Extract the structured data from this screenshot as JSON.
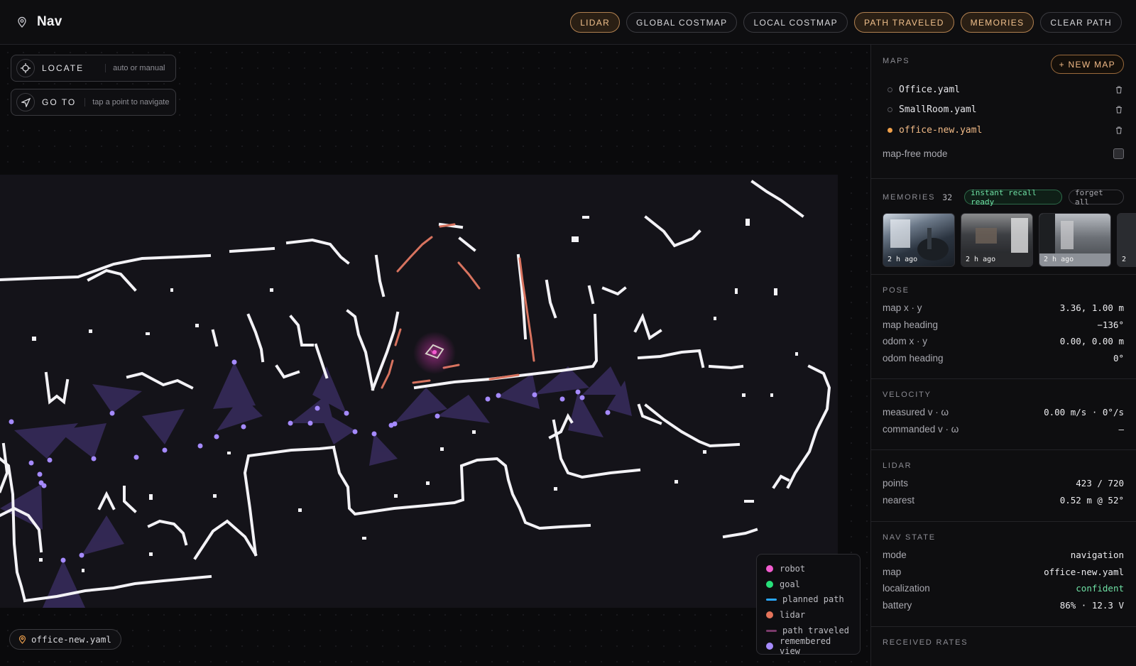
{
  "app": {
    "title": "Nav"
  },
  "toggles": [
    {
      "label": "LIDAR",
      "active": true
    },
    {
      "label": "GLOBAL COSTMAP",
      "active": false
    },
    {
      "label": "LOCAL COSTMAP",
      "active": false
    },
    {
      "label": "PATH TRAVELED",
      "active": true
    },
    {
      "label": "MEMORIES",
      "active": true
    },
    {
      "label": "CLEAR PATH",
      "active": false
    }
  ],
  "actions": {
    "locate": {
      "label": "LOCATE",
      "hint": "auto or manual"
    },
    "goto": {
      "label": "GO TO",
      "hint": "tap a point to navigate"
    }
  },
  "current_map_chip": "office-new.yaml",
  "legend": [
    {
      "label": "robot",
      "color": "#f25ccf",
      "kind": "dot"
    },
    {
      "label": "goal",
      "color": "#27e07a",
      "kind": "dot"
    },
    {
      "label": "planned path",
      "color": "#2aa8ff",
      "kind": "bar"
    },
    {
      "label": "lidar",
      "color": "#e4735a",
      "kind": "dot"
    },
    {
      "label": "path traveled",
      "color": "#7a3a6a",
      "kind": "bar"
    },
    {
      "label": "remembered view",
      "color": "#a68bff",
      "kind": "dot"
    }
  ],
  "sidebar": {
    "maps": {
      "heading": "MAPS",
      "new_label": "+ NEW MAP",
      "items": [
        {
          "name": "Office.yaml",
          "selected": false
        },
        {
          "name": "SmallRoom.yaml",
          "selected": false
        },
        {
          "name": "office-new.yaml",
          "selected": true
        }
      ],
      "map_free_label": "map-free mode"
    },
    "memories": {
      "heading": "MEMORIES",
      "count": "32",
      "status": "instant recall ready",
      "forget": "forget all",
      "thumbs": [
        {
          "ago": "2 h ago"
        },
        {
          "ago": "2 h ago"
        },
        {
          "ago": "2 h ago"
        },
        {
          "ago": "2"
        }
      ]
    },
    "pose": {
      "heading": "POSE",
      "rows": [
        {
          "k": "map x · y",
          "v": "3.36, 1.00 m"
        },
        {
          "k": "map heading",
          "v": "−136°"
        },
        {
          "k": "odom x · y",
          "v": "0.00, 0.00 m"
        },
        {
          "k": "odom heading",
          "v": "0°"
        }
      ]
    },
    "velocity": {
      "heading": "VELOCITY",
      "rows": [
        {
          "k": "measured v · ω",
          "v": "0.00 m/s · 0°/s"
        },
        {
          "k": "commanded v · ω",
          "v": "—"
        }
      ]
    },
    "lidar": {
      "heading": "LIDAR",
      "rows": [
        {
          "k": "points",
          "v": "423 / 720"
        },
        {
          "k": "nearest",
          "v": "0.52 m @ 52°"
        }
      ]
    },
    "navstate": {
      "heading": "NAV STATE",
      "rows": [
        {
          "k": "mode",
          "v": "navigation"
        },
        {
          "k": "map",
          "v": "office-new.yaml"
        },
        {
          "k": "localization",
          "v": "confident"
        },
        {
          "k": "battery",
          "v": "86% · 12.3 V"
        }
      ]
    },
    "rates": {
      "heading": "RECEIVED RATES"
    }
  }
}
